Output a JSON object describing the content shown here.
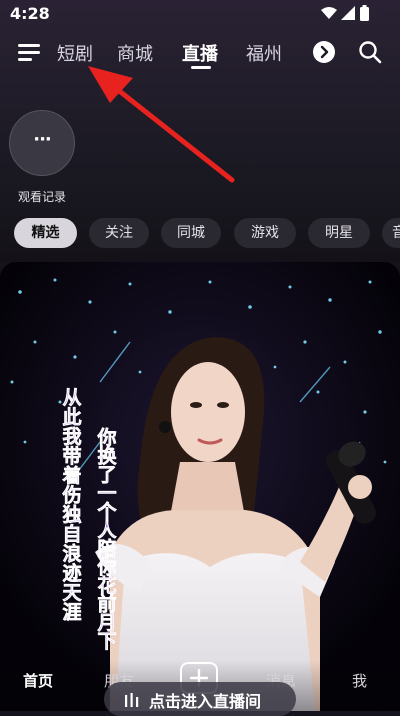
{
  "status_bar": {
    "time": "4:28"
  },
  "top_nav": {
    "tabs": [
      {
        "label": "短剧",
        "active": false
      },
      {
        "label": "商城",
        "active": false
      },
      {
        "label": "直播",
        "active": true
      },
      {
        "label": "福州",
        "active": false
      }
    ]
  },
  "history": {
    "button_glyph": "···",
    "label": "观看记录"
  },
  "chips": [
    {
      "label": "精选",
      "active": true
    },
    {
      "label": "关注",
      "active": false
    },
    {
      "label": "同城",
      "active": false
    },
    {
      "label": "游戏",
      "active": false
    },
    {
      "label": "明星",
      "active": false
    },
    {
      "label": "音",
      "active": false
    }
  ],
  "live_card": {
    "lyric_left": "从此我带着伤独自浪迹天涯",
    "lyric_right": "你换了一个人陪你花前月下"
  },
  "bottom_nav": {
    "items": [
      {
        "label": "首页",
        "active": true
      },
      {
        "label": "朋友",
        "active": false
      },
      {
        "label": "消息",
        "active": false
      },
      {
        "label": "我",
        "active": false
      }
    ]
  },
  "enter_live_label": "点击进入直播间",
  "colors": {
    "annotation_arrow": "#e8231f",
    "lyric_text": "#8a3cd6"
  }
}
